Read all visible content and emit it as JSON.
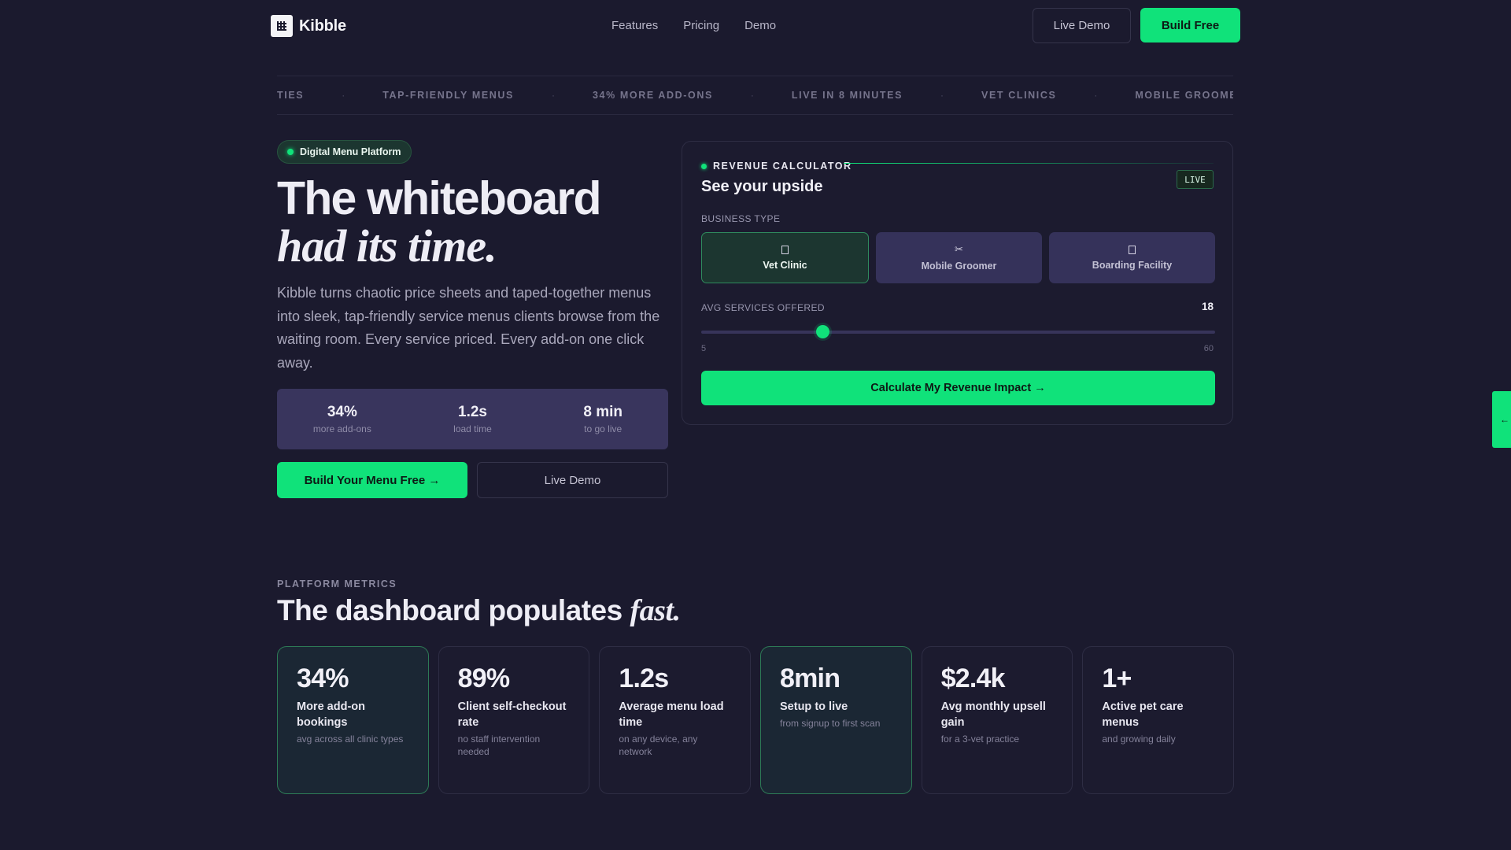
{
  "nav": {
    "brand": "Kibble",
    "links": [
      "Features",
      "Pricing",
      "Demo"
    ],
    "live_demo": "Live Demo",
    "build_free": "Build Free"
  },
  "ticker": {
    "items": [
      "CILITIES",
      "TAP-FRIENDLY MENUS",
      "34% MORE ADD-ONS",
      "LIVE IN 8 MINUTES",
      "VET CLINICS",
      "MOBILE GROOMERS"
    ],
    "separator": "·"
  },
  "hero": {
    "badge": "Digital Menu Platform",
    "title_line1": "The whiteboard",
    "title_line2": "had its time.",
    "subtitle": "Kibble turns chaotic price sheets and taped-together menus into sleek, tap-friendly service menus clients browse from the waiting room. Every service priced. Every add-on one click away.",
    "stats": [
      {
        "value": "34%",
        "label": "more add-ons"
      },
      {
        "value": "1.2s",
        "label": "load time"
      },
      {
        "value": "8 min",
        "label": "to go live"
      }
    ],
    "cta_primary": "Build Your Menu Free →",
    "cta_secondary": "Live Demo"
  },
  "calculator": {
    "eyebrow": "REVENUE CALCULATOR",
    "live": "LIVE",
    "title": "See your upside",
    "business_type_label": "BUSINESS TYPE",
    "types": [
      {
        "label": "Vet Clinic",
        "icon": "box-icon",
        "active": true
      },
      {
        "label": "Mobile Groomer",
        "icon": "scissors-icon",
        "glyph": "✂",
        "active": false
      },
      {
        "label": "Boarding Facility",
        "icon": "box-icon",
        "active": false
      }
    ],
    "services_label": "AVG SERVICES OFFERED",
    "services_value": "18",
    "services_min": "5",
    "services_max": "60",
    "services_fraction": 0.2364,
    "cta": "Calculate My Revenue Impact →"
  },
  "side_tab": {
    "glyph": "←"
  },
  "metrics": {
    "eyebrow": "PLATFORM METRICS",
    "title": "The dashboard populates",
    "title_italic": "fast.",
    "cards": [
      {
        "value": "34%",
        "label": "More add-on bookings",
        "sub": "avg across all clinic types",
        "highlight": true
      },
      {
        "value": "89%",
        "label": "Client self-checkout rate",
        "sub": "no staff intervention needed",
        "highlight": false
      },
      {
        "value": "1.2s",
        "label": "Average menu load time",
        "sub": "on any device, any network",
        "highlight": false
      },
      {
        "value": "8min",
        "label": "Setup to live",
        "sub": "from signup to first scan",
        "highlight": true
      },
      {
        "value": "$2.4k",
        "label": "Avg monthly upsell gain",
        "sub": "for a 3-vet practice",
        "highlight": false
      },
      {
        "value": "1+",
        "label": "Active pet care menus",
        "sub": "and growing daily",
        "highlight": false
      }
    ]
  },
  "colors": {
    "accent": "#10e27a",
    "background": "#1b1a2e",
    "card": "#1c1b2f",
    "stat_bar": "#39355d"
  }
}
